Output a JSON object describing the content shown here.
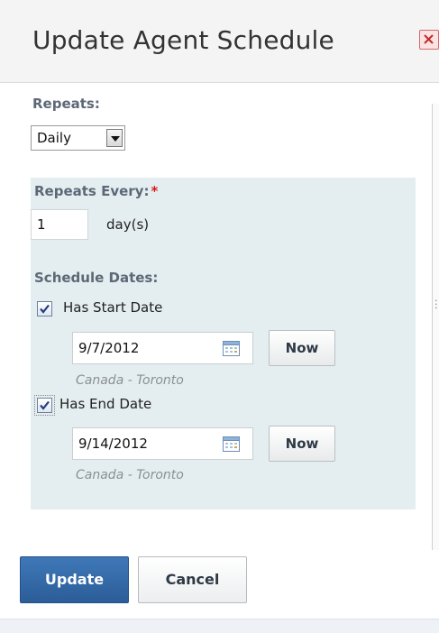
{
  "dialog": {
    "title": "Update Agent Schedule"
  },
  "repeats": {
    "label": "Repeats:",
    "selected": "Daily"
  },
  "repeats_every": {
    "label": "Repeats Every:",
    "required_mark": "*",
    "value": "1",
    "unit": "day(s)"
  },
  "schedule_dates": {
    "label": "Schedule Dates:",
    "start": {
      "checkbox_label": "Has Start Date",
      "checked": true,
      "date": "9/7/2012",
      "now_label": "Now",
      "timezone": "Canada - Toronto"
    },
    "end": {
      "checkbox_label": "Has End Date",
      "checked": true,
      "date": "9/14/2012",
      "now_label": "Now",
      "timezone": "Canada - Toronto"
    }
  },
  "actions": {
    "update_label": "Update",
    "cancel_label": "Cancel"
  },
  "icons": {
    "close": "close-icon",
    "calendar": "calendar-icon",
    "checkmark": "checkmark-icon",
    "dropdown": "chevron-down-icon"
  },
  "colors": {
    "label": "#5d6877",
    "panel": "#e4eef0",
    "primary": "#2f66a8",
    "required": "#d61d1d"
  }
}
